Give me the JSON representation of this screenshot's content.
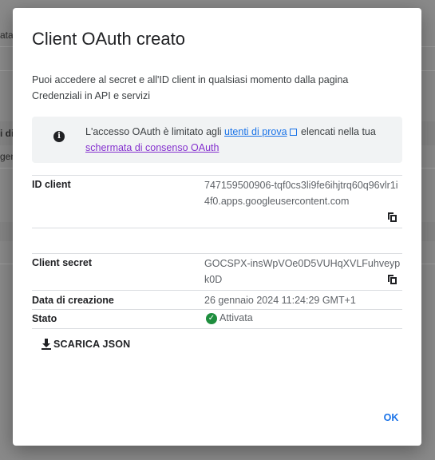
{
  "background": {
    "fragments": [
      "ata",
      "i di",
      "gen"
    ]
  },
  "dialog": {
    "title": "Client OAuth creato",
    "description": "Puoi accedere al secret e all'ID client in qualsiasi momento dalla pagina Credenziali in API e servizi",
    "notice": {
      "icon": "info-icon",
      "text_before": "L'accesso OAuth è limitato agli ",
      "link1": "utenti di prova",
      "text_middle": " elencati nella tua ",
      "link2": "schermata di consenso OAuth"
    },
    "fields": {
      "client_id_label": "ID client",
      "client_id_value": "747159500906-tqf0cs3li9fe6ihjtrq60q96vlr1i4f0.apps.googleusercontent.com",
      "client_secret_label": "Client secret",
      "client_secret_value": "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",
      "creation_label": "Data di creazione",
      "creation_value": "26 gennaio 2024 11:24:29 GMT+1",
      "status_label": "Stato",
      "status_value": "Attivata"
    },
    "download_label": "SCARICA JSON",
    "ok_label": "OK"
  },
  "colors": {
    "accent": "#1a73e8",
    "visited_link": "#8430ce",
    "success": "#1e8e3e"
  }
}
